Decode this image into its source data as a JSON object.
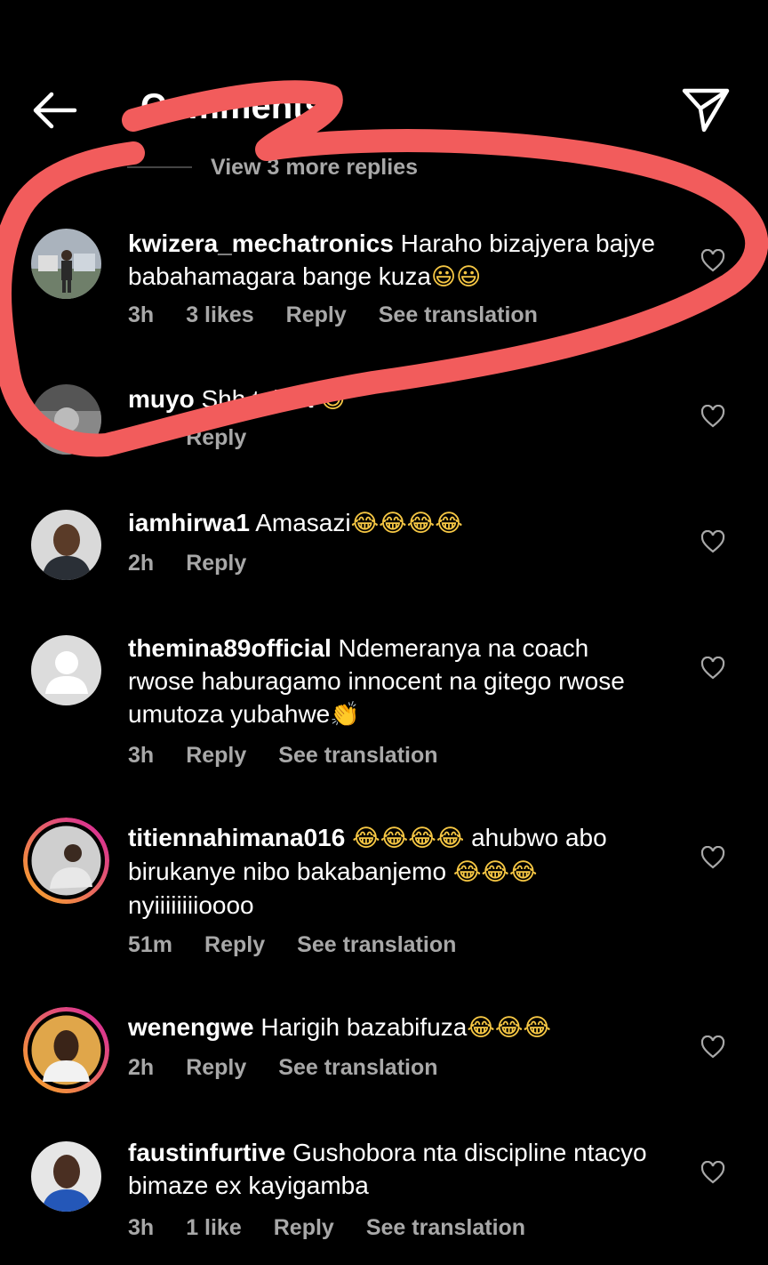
{
  "header": {
    "title": "Comments",
    "back_icon": "arrow-left-icon",
    "send_icon": "paper-plane-icon"
  },
  "view_more": "View 3 more replies",
  "comments": [
    {
      "user": "kwizera_mechatronics",
      "text": "Haraho bizajyera bajye babahamagara bange kuza",
      "emoji": "😃😃",
      "time": "3h",
      "likes": "3 likes",
      "reply": "Reply",
      "translate": "See translation"
    },
    {
      "user": "muyo",
      "text": "Shh talent",
      "emoji": "😅",
      "time": "2h",
      "reply": "Reply"
    },
    {
      "user": "iamhirwa1",
      "text": "Amasazi",
      "emoji": "😂😂😂😂",
      "time": "2h",
      "reply": "Reply"
    },
    {
      "user": "themina89official",
      "text": "Ndemeranya na coach rwose haburagamo innocent na gitego rwose umutoza yubahwe",
      "emoji": "👏",
      "time": "3h",
      "reply": "Reply",
      "translate": "See translation"
    },
    {
      "user": "titiennahimana016",
      "text_a": "😂😂😂😂",
      "text_b": "ahubwo abo birukanye nibo bakabanjemo",
      "emoji": "😂😂😂",
      "text_c": "nyiiiiiiiioooo",
      "time": "51m",
      "reply": "Reply",
      "translate": "See translation"
    },
    {
      "user": "wenengwe",
      "text": "Harigih bazabifuza",
      "emoji": "😂😂😂",
      "time": "2h",
      "reply": "Reply",
      "translate": "See translation"
    },
    {
      "user": "faustinfurtive",
      "text": "Gushobora nta discipline ntacyo bimaze ex kayigamba",
      "time": "3h",
      "likes": "1 like",
      "reply": "Reply",
      "translate": "See translation"
    }
  ],
  "colors": {
    "background": "#000000",
    "secondary_text": "#a8a8a8",
    "annotation": "#f25c5c",
    "story_ring_start": "#f9a825",
    "story_ring_end": "#d6249f"
  }
}
